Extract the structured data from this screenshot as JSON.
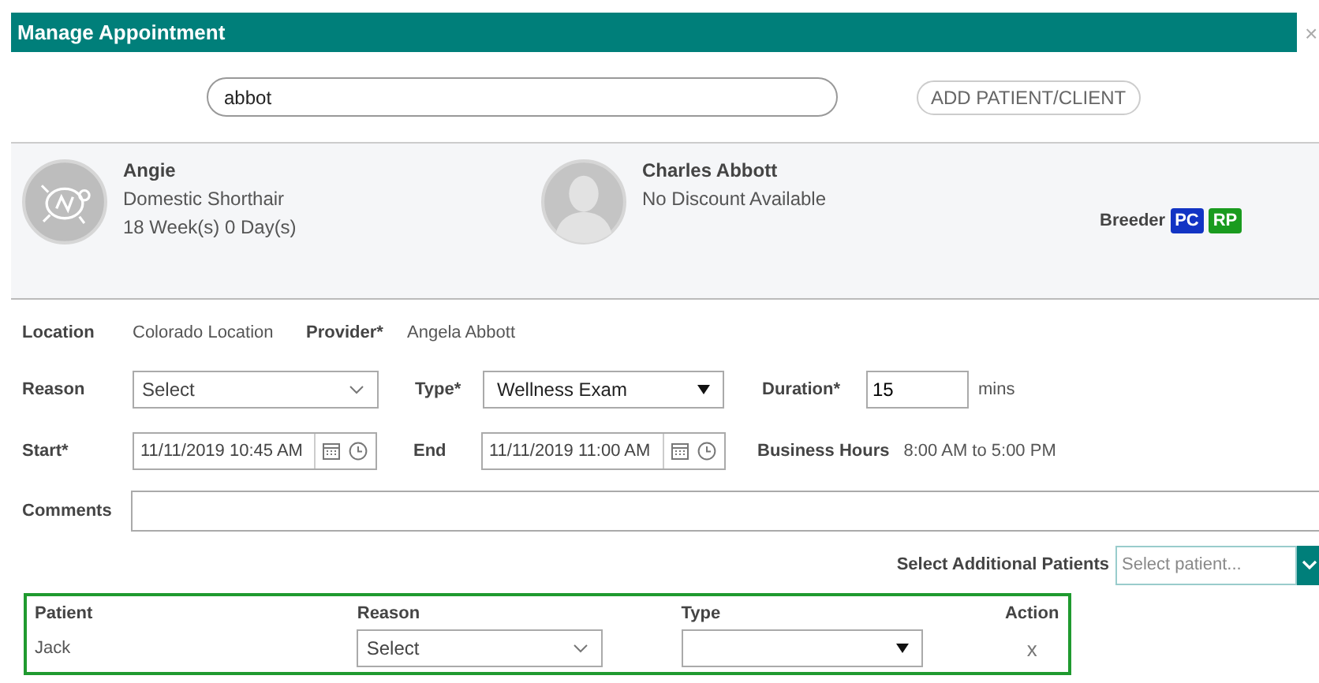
{
  "window": {
    "title": "Manage Appointment",
    "close": "×"
  },
  "search": {
    "value": "abbot"
  },
  "add_button": "ADD PATIENT/CLIENT",
  "patient": {
    "name": "Angie",
    "breed": "Domestic Shorthair",
    "age": "18 Week(s) 0 Day(s)"
  },
  "client": {
    "name": "Charles Abbott",
    "discount": "No Discount Available",
    "tag": "Breeder",
    "badges": [
      {
        "text": "PC",
        "color": "#1234c4"
      },
      {
        "text": "RP",
        "color": "#1a9b1f"
      }
    ]
  },
  "form": {
    "location_label": "Location",
    "location": "Colorado Location",
    "provider_label": "Provider*",
    "provider": "Angela Abbott",
    "reason_label": "Reason",
    "reason": "Select",
    "type_label": "Type*",
    "type": "Wellness Exam",
    "duration_label": "Duration*",
    "duration": "15",
    "duration_unit": "mins",
    "start_label": "Start*",
    "start": "11/11/2019 10:45 AM",
    "end_label": "End",
    "end": "11/11/2019 11:00 AM",
    "hours_label": "Business Hours",
    "hours": "8:00 AM to 5:00 PM",
    "comments_label": "Comments"
  },
  "additional": {
    "label": "Select Additional Patients",
    "placeholder": "Select patient..."
  },
  "patients_table": {
    "columns": [
      "Patient",
      "Reason",
      "Type",
      "Action"
    ],
    "rows": [
      {
        "patient": "Jack",
        "reason": "Select",
        "action": "x"
      }
    ]
  }
}
